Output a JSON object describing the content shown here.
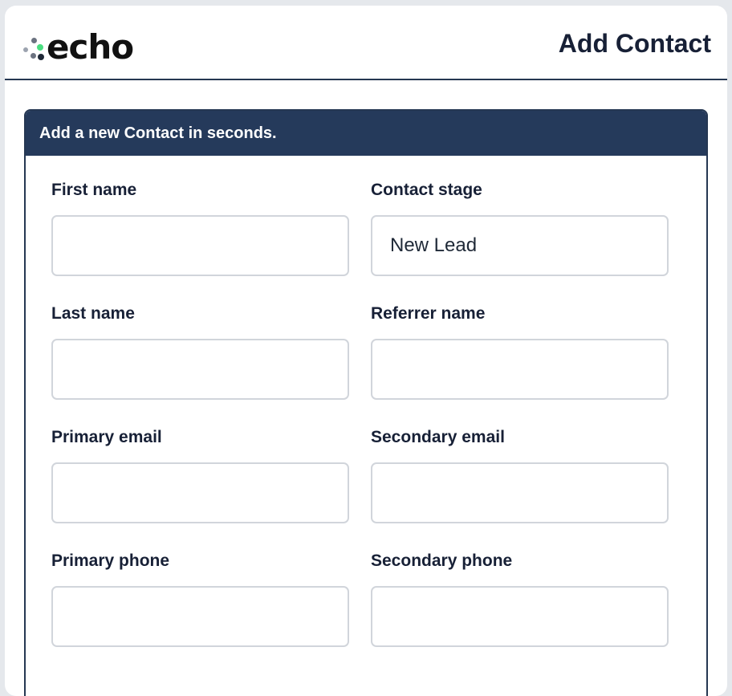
{
  "header": {
    "brand": "echo",
    "page_title": "Add Contact"
  },
  "panel": {
    "heading": "Add a new Contact in seconds."
  },
  "form": {
    "first_name": {
      "label": "First name",
      "value": ""
    },
    "contact_stage": {
      "label": "Contact stage",
      "value": "New Lead"
    },
    "last_name": {
      "label": "Last name",
      "value": ""
    },
    "referrer_name": {
      "label": "Referrer name",
      "value": ""
    },
    "primary_email": {
      "label": "Primary email",
      "value": ""
    },
    "secondary_email": {
      "label": "Secondary email",
      "value": ""
    },
    "primary_phone": {
      "label": "Primary phone",
      "value": ""
    },
    "secondary_phone": {
      "label": "Secondary phone",
      "value": ""
    }
  },
  "colors": {
    "header_rule": "#253752",
    "panel_header": "#253a5b",
    "input_border": "#d1d5db",
    "logo_dots": [
      "#6b7280",
      "#4ade80",
      "#9ca3af",
      "#1f2937"
    ]
  }
}
